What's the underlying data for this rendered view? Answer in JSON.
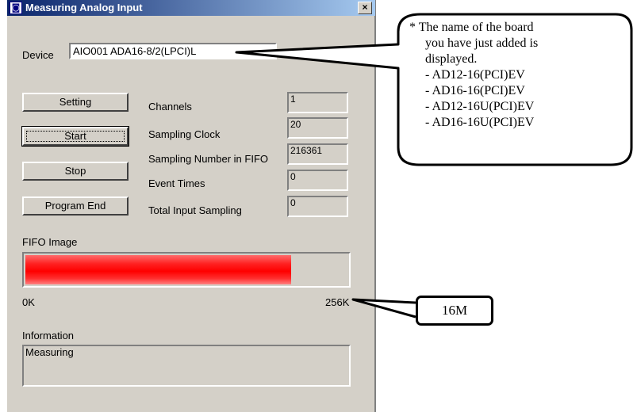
{
  "window": {
    "title": "Measuring Analog Input",
    "close_glyph": "×",
    "icon": "app-icon"
  },
  "device": {
    "label": "Device",
    "value": "AIO001 ADA16-8/2(LPCI)L"
  },
  "buttons": {
    "setting": "Setting",
    "start": "Start",
    "stop": "Stop",
    "program_end": "Program End"
  },
  "stats": [
    {
      "label": "Channels",
      "value": "1"
    },
    {
      "label": "Sampling Clock",
      "value": "20"
    },
    {
      "label": "Sampling Number in FIFO",
      "value": "216361"
    },
    {
      "label": "Event Times",
      "value": "0"
    },
    {
      "label": "Total Input Sampling",
      "value": "0"
    }
  ],
  "fifo": {
    "label": "FIFO Image",
    "fill_fraction": 0.826,
    "min_label": "0K",
    "max_label": "256K",
    "fill_color": "#ff0000"
  },
  "information": {
    "label": "Information",
    "value": "Measuring"
  },
  "callouts": {
    "board_note": {
      "line1": "* The name of the board",
      "line2": "you have just added is",
      "line3": "displayed.",
      "items": [
        "- AD12-16(PCI)EV",
        "- AD16-16(PCI)EV",
        "- AD12-16U(PCI)EV",
        "- AD16-16U(PCI)EV"
      ]
    },
    "fifo_note": "16M"
  }
}
